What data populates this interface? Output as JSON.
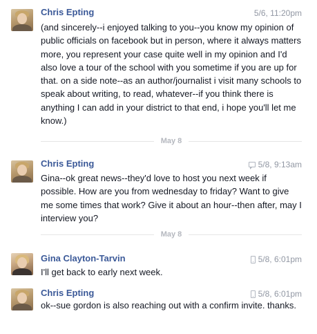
{
  "messages": [
    {
      "sender": "Chris Epting",
      "time": "5/6, 11:20pm",
      "icon": "none",
      "text": "(and sincerely--i enjoyed talking to you--you know my opinion of public officials on facebook but in person, where it always matters more, you represent your case quite well in my opinion and I'd also love a tour of the school with you sometime if you are up for that. on a side note--as an author/journalist i visit many schools to speak about writing, to read, whatever--if you think there is anything I can add in your district to that end, i hope you'll let me know.)"
    },
    {
      "sender": "Chris Epting",
      "time": "5/8, 9:13am",
      "icon": "chat-icon",
      "text": "Gina--ok great news--they'd love to host you next week if possible. How are you from wednesday to friday? Want to give me some times that work? Give it about an hour--then after, may I interview you?"
    },
    {
      "sender": "Gina Clayton-Tarvin",
      "time": "5/8, 6:01pm",
      "icon": "mobile-phone-icon",
      "text": "I'll get back to early next week."
    },
    {
      "sender": "Chris Epting",
      "time": "5/8, 6:01pm",
      "icon": "mobile-phone-icon",
      "text": "ok--sue gordon is also reaching out with a confirm invite. thanks."
    }
  ],
  "dividers": [
    "May 8",
    "May 8"
  ]
}
